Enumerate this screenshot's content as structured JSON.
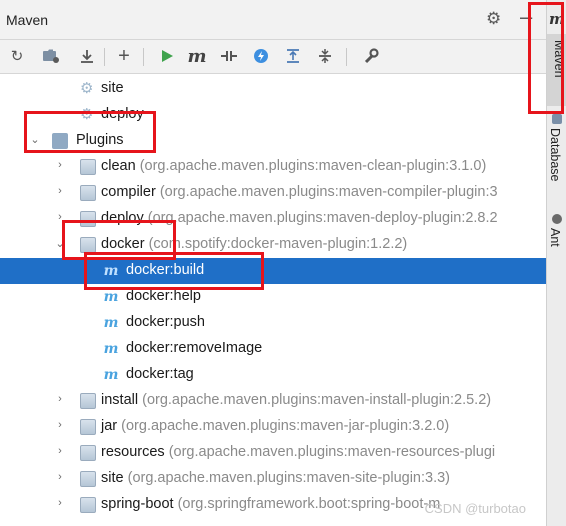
{
  "window": {
    "title": "Maven"
  },
  "toolbar": {
    "buttons": [
      "reload-icon",
      "reimport-folder-icon",
      "download-icon",
      "add-icon",
      "run-icon",
      "execute-goal-icon",
      "toggle-offline-icon",
      "skip-tests-icon",
      "show-dependencies-icon",
      "expand-all-icon",
      "collapse-all-icon",
      "settings-wrench-icon"
    ]
  },
  "tree": {
    "lifecycle": [
      {
        "label": "site"
      },
      {
        "label": "deploy"
      }
    ],
    "plugins_label": "Plugins",
    "plugins": [
      {
        "name": "clean",
        "detail": "(org.apache.maven.plugins:maven-clean-plugin:3.1.0)"
      },
      {
        "name": "compiler",
        "detail": "(org.apache.maven.plugins:maven-compiler-plugin:3"
      },
      {
        "name": "deploy",
        "detail": "(org.apache.maven.plugins:maven-deploy-plugin:2.8.2"
      },
      {
        "name": "docker",
        "detail": "(com.spotify:docker-maven-plugin:1.2.2)"
      },
      {
        "name": "install",
        "detail": "(org.apache.maven.plugins:maven-install-plugin:2.5.2)"
      },
      {
        "name": "jar",
        "detail": "(org.apache.maven.plugins:maven-jar-plugin:3.2.0)"
      },
      {
        "name": "resources",
        "detail": "(org.apache.maven.plugins:maven-resources-plugi"
      },
      {
        "name": "site",
        "detail": "(org.apache.maven.plugins:maven-site-plugin:3.3)"
      },
      {
        "name": "spring-boot",
        "detail": "(org.springframework.boot:spring-boot-m"
      }
    ],
    "docker_goals": [
      "docker:build",
      "docker:help",
      "docker:push",
      "docker:removeImage",
      "docker:tag"
    ],
    "selected_goal": "docker:build"
  },
  "sidebar": {
    "logo": "m",
    "tabs": [
      "Maven",
      "Database",
      "Ant"
    ]
  },
  "watermark": "CSDN @turbotao",
  "colors": {
    "selection": "#1f6fc7",
    "highlight_box": "#e6141b",
    "maven_goal_icon": "#4aa3df"
  }
}
